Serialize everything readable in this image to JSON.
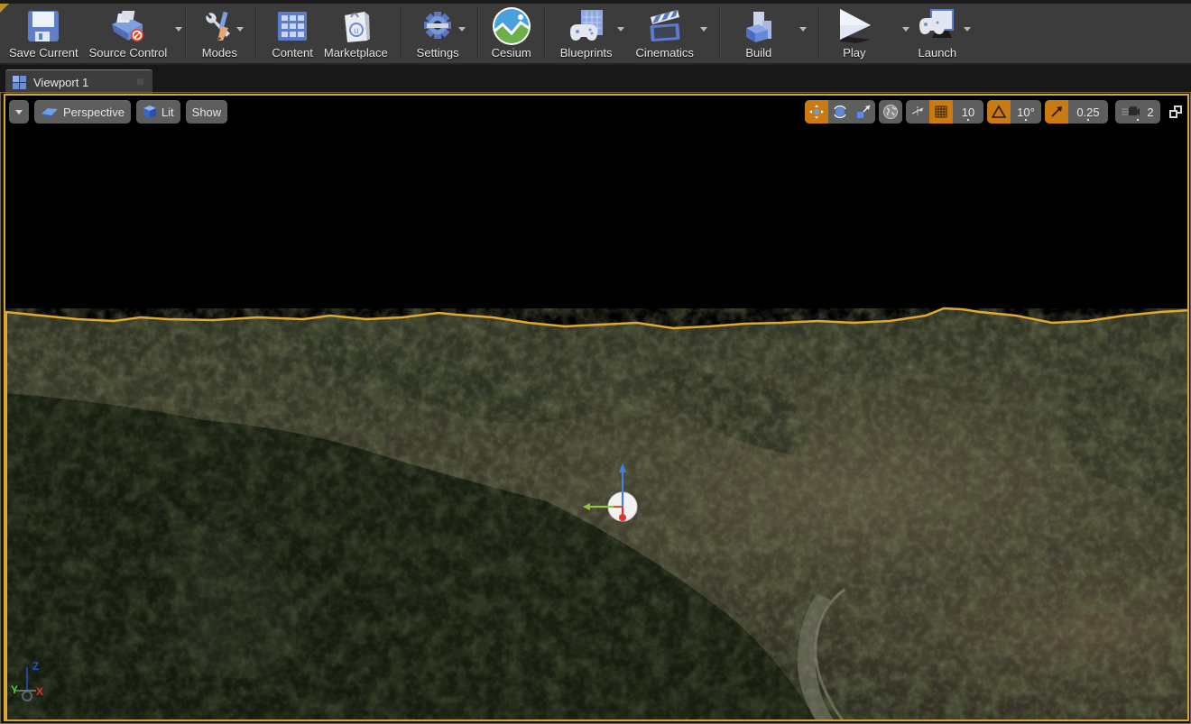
{
  "toolbar": {
    "items": [
      {
        "label": "Save Current",
        "icon": "save-floppy-icon",
        "has_dropdown": false
      },
      {
        "label": "Source Control",
        "icon": "source-control-icon",
        "has_dropdown": true
      },
      {
        "label": "Modes",
        "icon": "modes-tools-icon",
        "has_dropdown": true
      },
      {
        "label": "Content",
        "icon": "content-browser-icon",
        "has_dropdown": false
      },
      {
        "label": "Marketplace",
        "icon": "marketplace-bag-icon",
        "has_dropdown": false
      },
      {
        "label": "Settings",
        "icon": "settings-gear-icon",
        "has_dropdown": true
      },
      {
        "label": "Cesium",
        "icon": "cesium-logo-icon",
        "has_dropdown": false
      },
      {
        "label": "Blueprints",
        "icon": "blueprints-gamepad-icon",
        "has_dropdown": true
      },
      {
        "label": "Cinematics",
        "icon": "cinematics-clapper-icon",
        "has_dropdown": true
      },
      {
        "label": "Build",
        "icon": "build-blocks-icon",
        "has_dropdown": true
      },
      {
        "label": "Play",
        "icon": "play-icon",
        "has_dropdown": true
      },
      {
        "label": "Launch",
        "icon": "launch-monitor-icon",
        "has_dropdown": true
      }
    ]
  },
  "tabs": [
    {
      "label": "Viewport 1",
      "icon": "viewport-grid-icon",
      "active": true
    }
  ],
  "viewport": {
    "left_controls": {
      "menu_icon": "chevron-down-icon",
      "perspective_label": "Perspective",
      "lit_label": "Lit",
      "show_label": "Show"
    },
    "right_controls": {
      "transform_modes": [
        "translate",
        "rotate",
        "scale"
      ],
      "active_transform": "translate",
      "coordinate_space": "world",
      "grid_snap_enabled": true,
      "grid_snap_value": "10",
      "rotation_snap_enabled": true,
      "rotation_snap_value": "10°",
      "scale_snap_enabled": true,
      "scale_snap_value": "0.25",
      "camera_speed_value": "2"
    },
    "axis_labels": {
      "x": "X",
      "y": "Y",
      "z": "Z"
    },
    "selection_outline_color": "#e0a832",
    "active_accent_color": "#c97a12"
  }
}
